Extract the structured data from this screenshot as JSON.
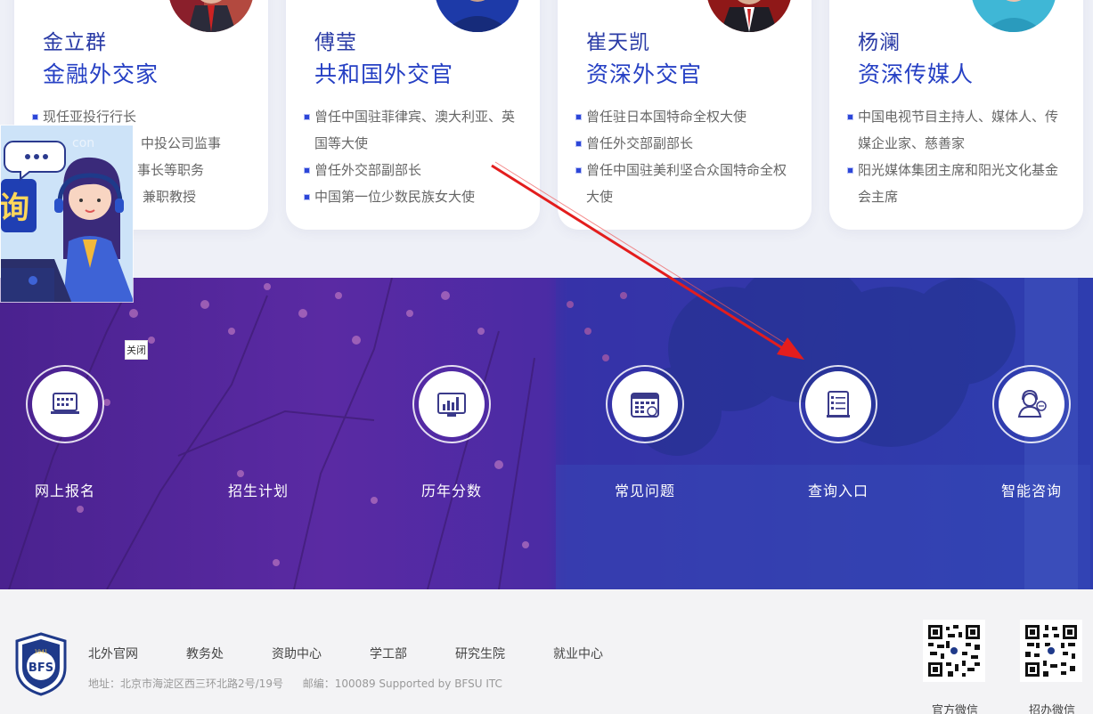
{
  "cards": [
    {
      "name": "金立群",
      "title": "金融外交家",
      "items": [
        "现任亚投行行长",
        "长、中投公司监事",
        "事长等职务",
        "兼职教授"
      ]
    },
    {
      "name": "傅莹",
      "title": "共和国外交官",
      "items": [
        "曾任中国驻菲律宾、澳大利亚、英国等大使",
        "曾任外交部副部长",
        "中国第一位少数民族女大使"
      ]
    },
    {
      "name": "崔天凯",
      "title": "资深外交官",
      "items": [
        "曾任驻日本国特命全权大使",
        "曾任外交部副部长",
        "曾任中国驻美利坚合众国特命全权大使"
      ]
    },
    {
      "name": "杨澜",
      "title": "资深传媒人",
      "items": [
        "中国电视节目主持人、媒体人、传媒企业家、慈善家",
        "阳光媒体集团主席和阳光文化基金会主席"
      ]
    }
  ],
  "quick_links": [
    {
      "label": "网上报名",
      "icon": "laptop-calendar-icon"
    },
    {
      "label": "招生计划",
      "icon": "chart-monitor-icon"
    },
    {
      "label": "历年分数",
      "icon": "calendar-icon"
    },
    {
      "label": "常见问题",
      "icon": "calendar-grid-icon"
    },
    {
      "label": "查询入口",
      "icon": "document-list-icon"
    },
    {
      "label": "智能咨询",
      "icon": "headset-agent-icon"
    }
  ],
  "consult_widget": {
    "close_label": "关闭",
    "badge_text": "询",
    "badge_sub": "con"
  },
  "footer": {
    "links": [
      "北外官网",
      "教务处",
      "资助中心",
      "学工部",
      "研究生院",
      "就业中心"
    ],
    "address": "地址：北京市海淀区西三环北路2号/19号",
    "postcode": "邮编：100089 Supported by BFSU ITC",
    "logo_text": "BFS",
    "logo_year": "1941",
    "qr": [
      {
        "label": "官方微信"
      },
      {
        "label": "招办微信"
      }
    ]
  },
  "colors": {
    "accent_blue": "#2640c4",
    "banner_purple": "#4a228f",
    "banner_blue": "#2f3eb2",
    "arrow_red": "#e31d1d"
  }
}
